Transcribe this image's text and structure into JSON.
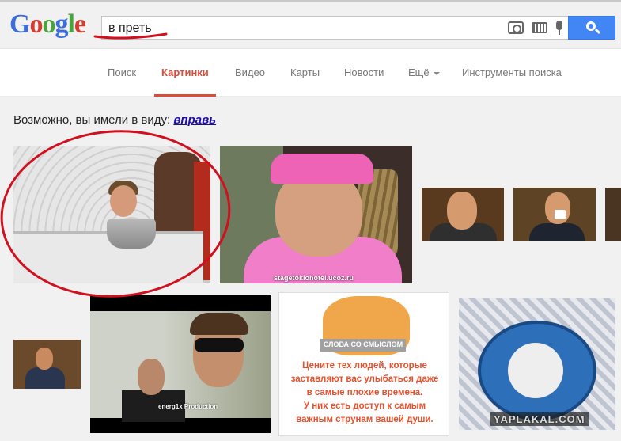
{
  "logo": {
    "text": "Google",
    "letters": [
      "G",
      "o",
      "o",
      "g",
      "l",
      "e"
    ],
    "colors": [
      "#3b6edc",
      "#d63c2f",
      "#4aa33f",
      "#3b6edc",
      "#4aa33f",
      "#d63c2f"
    ]
  },
  "search": {
    "value": "в преть"
  },
  "tabs": [
    {
      "label": "Поиск"
    },
    {
      "label": "Картинки",
      "active": true
    },
    {
      "label": "Видео"
    },
    {
      "label": "Карты"
    },
    {
      "label": "Новости"
    },
    {
      "label": "Ещё"
    },
    {
      "label": "Инструменты поиска"
    }
  ],
  "suggestion": {
    "prefix": "Возможно, вы имели в виду:",
    "link": "вправь"
  },
  "images": {
    "img2_watermark": "stagetokiohotel.ucoz.ru",
    "img7_watermark": "energ1x Production",
    "img8_banner": "СЛОВА СО СМЫСЛОМ",
    "img8_quote": [
      "Цените тех людей, которые",
      "заставляют вас улыбаться даже",
      "в самые плохие времена.",
      "У них есть доступ к самым",
      "важным струнам вашей души."
    ],
    "img9_watermark": "YAPLAKAL.COM"
  },
  "colors": {
    "accent": "#dd4b39",
    "link": "#1a0dab",
    "search_button": "#4285f4",
    "annotation": "#d0101e"
  }
}
